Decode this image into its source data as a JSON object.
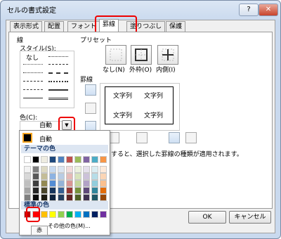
{
  "window": {
    "title": "セルの書式設定",
    "help_btn": "?",
    "close_btn": "✕"
  },
  "tabs": [
    "表示形式",
    "配置",
    "フォント",
    "罫線",
    "塗りつぶし",
    "保護"
  ],
  "line": {
    "group_label": "線",
    "style_label": "スタイル(S):",
    "none_label": "なし",
    "color_label": "色(C):",
    "color_value": "自動"
  },
  "presets": {
    "label": "プリセット",
    "items": [
      {
        "label": "なし(N)"
      },
      {
        "label": "外枠(O)"
      },
      {
        "label": "内側(I)"
      }
    ]
  },
  "borders": {
    "label": "罫線",
    "preview_text": [
      "文字列",
      "文字列",
      "文字列",
      "文字列"
    ],
    "hint": "すると、選択した罫線の種類が適用されます。"
  },
  "popup": {
    "auto_label": "自動",
    "theme_header": "テーマの色",
    "standard_header": "標準の色",
    "more_colors": "その他の色(M)...",
    "tooltip": "赤",
    "theme_top": [
      "#ffffff",
      "#000000",
      "#eeece1",
      "#1f497d",
      "#4f81bd",
      "#c0504d",
      "#9bbb59",
      "#8064a2",
      "#4bacc6",
      "#f79646"
    ],
    "theme_shades": [
      [
        "#f2f2f2",
        "#7f7f7f",
        "#ddd9c3",
        "#c6d9f0",
        "#dbe5f1",
        "#f2dcdb",
        "#ebf1dd",
        "#e5e0ec",
        "#dbeef3",
        "#fdeada"
      ],
      [
        "#d8d8d8",
        "#595959",
        "#c4bd97",
        "#8db3e2",
        "#b8cce4",
        "#e5b9b7",
        "#d7e3bc",
        "#ccc1d9",
        "#b7dde8",
        "#fbd5b5"
      ],
      [
        "#bfbfbf",
        "#3f3f3f",
        "#938953",
        "#548dd4",
        "#95b3d7",
        "#d99694",
        "#c3d69b",
        "#b2a2c7",
        "#92cddc",
        "#fac08f"
      ],
      [
        "#a5a5a5",
        "#262626",
        "#494429",
        "#17365d",
        "#366092",
        "#953734",
        "#76923c",
        "#5f497a",
        "#31859b",
        "#e36c09"
      ],
      [
        "#7f7f7f",
        "#0c0c0c",
        "#1d1b10",
        "#0f243e",
        "#244061",
        "#632423",
        "#4f6128",
        "#3f3151",
        "#205867",
        "#974806"
      ]
    ],
    "standard": [
      "#c00000",
      "#ff0000",
      "#ffc000",
      "#ffff00",
      "#92d050",
      "#00b050",
      "#00b0f0",
      "#0070c0",
      "#002060",
      "#7030a0"
    ]
  },
  "buttons": {
    "ok": "OK",
    "cancel": "キャンセル"
  }
}
